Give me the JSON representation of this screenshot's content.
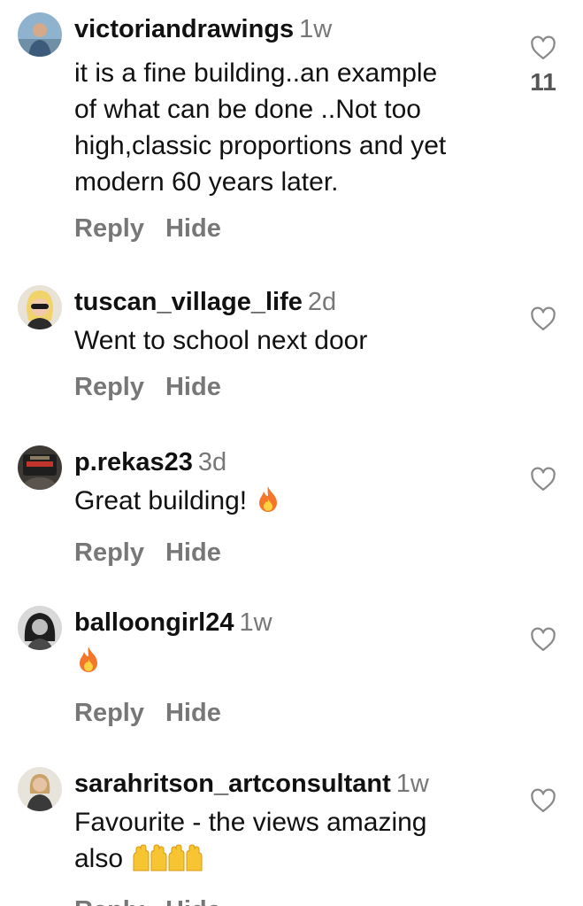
{
  "comments": [
    {
      "username": "victoriandrawings",
      "time": "1w",
      "lines": [
        "it is a fine building..an example",
        "of what can be done ..Not too",
        "high,classic proportions and yet",
        "modern 60 years later."
      ],
      "reply_label": "Reply",
      "hide_label": "Hide",
      "like_count": "11"
    },
    {
      "username": "tuscan_village_life",
      "time": "2d",
      "lines": [
        "Went to school next door"
      ],
      "reply_label": "Reply",
      "hide_label": "Hide"
    },
    {
      "username": "p.rekas23",
      "time": "3d",
      "lines": [
        "Great building!"
      ],
      "emoji": "fire-emoji",
      "reply_label": "Reply",
      "hide_label": "Hide"
    },
    {
      "username": "balloongirl24",
      "time": "1w",
      "lines": [],
      "emoji": "fire-emoji",
      "reply_label": "Reply",
      "hide_label": "Hide"
    },
    {
      "username": "sarahritson_artconsultant",
      "time": "1w",
      "lines": [
        "Favourite - the views amazing",
        "also"
      ],
      "emoji": "raising-hands-emoji",
      "reply_label": "Reply",
      "hide_label": "Hide"
    }
  ],
  "icons": {
    "like": "heart-outline-icon"
  },
  "colors": {
    "text": "#111111",
    "muted": "#777777"
  }
}
